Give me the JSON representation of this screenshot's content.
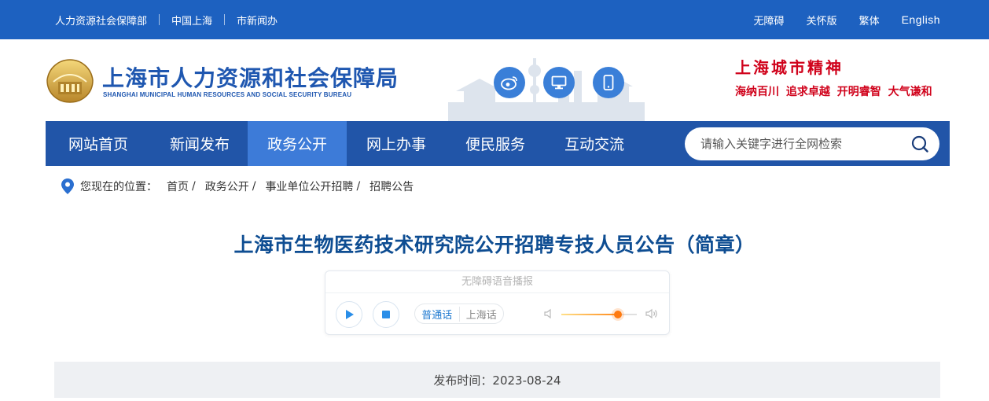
{
  "topbar": {
    "left_links": [
      "人力资源社会保障部",
      "中国上海",
      "市新闻办"
    ],
    "right_links": [
      "无障碍",
      "关怀版",
      "繁体",
      "English"
    ]
  },
  "header": {
    "title": "上海市人力资源和社会保障局",
    "subtitle": "SHANGHAI MUNICIPAL HUMAN RESOURCES AND SOCIAL SECURITY BUREAU",
    "icons": [
      "weibo-icon",
      "desktop-icon",
      "mobile-icon"
    ],
    "spirit_title": "上海城市精神",
    "spirit_words": "海纳百川 追求卓越 开明睿智 大气谦和"
  },
  "nav": {
    "items": [
      "网站首页",
      "新闻发布",
      "政务公开",
      "网上办事",
      "便民服务",
      "互动交流"
    ],
    "active_index": 2,
    "search_placeholder": "请输入关键字进行全网检索"
  },
  "breadcrumb": {
    "label": "您现在的位置：",
    "items": [
      "首页",
      "政务公开",
      "事业单位公开招聘",
      "招聘公告"
    ]
  },
  "article": {
    "title": "上海市生物医药技术研究院公开招聘专技人员公告（简章）"
  },
  "player": {
    "title": "无障碍语音播报",
    "lang_options": [
      "普通话",
      "上海话"
    ],
    "selected_lang": "普通话",
    "volume": 0.75
  },
  "publish": {
    "text": "发布时间：2023-08-24"
  },
  "colors": {
    "topbar": "#1d61c0",
    "nav": "#2155a8",
    "nav_active": "#3d7bd8",
    "title_blue": "#0e4d92",
    "spirit_red": "#d0021b"
  }
}
